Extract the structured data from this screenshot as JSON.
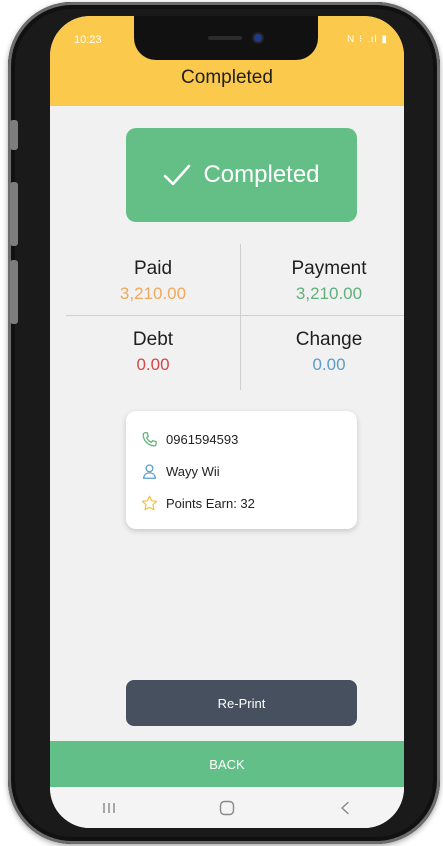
{
  "status_bar": {
    "time": "10:23",
    "icons": "N ⁝ .ıl ▮"
  },
  "header": {
    "title": "Completed",
    "color": "#fbc94b"
  },
  "banner": {
    "label": "Completed",
    "icon": "check-icon",
    "color": "#64bf86"
  },
  "summary": {
    "paid": {
      "label": "Paid",
      "value": "3,210.00",
      "color": "#f0a85a"
    },
    "payment": {
      "label": "Payment",
      "value": "3,210.00",
      "color": "#5fb07a"
    },
    "debt": {
      "label": "Debt",
      "value": "0.00",
      "color": "#d34848"
    },
    "change": {
      "label": "Change",
      "value": "0.00",
      "color": "#5a9dcb"
    }
  },
  "customer": {
    "phone": "0961594593",
    "name": "Wayy Wii",
    "points": "Points Earn: 32",
    "icons": [
      "phone-icon",
      "user-icon",
      "star-icon"
    ]
  },
  "buttons": {
    "reprint": "Re-Print",
    "back": "BACK"
  },
  "nav_bar": {
    "icons": [
      "recents-icon",
      "home-icon",
      "back-icon"
    ]
  }
}
